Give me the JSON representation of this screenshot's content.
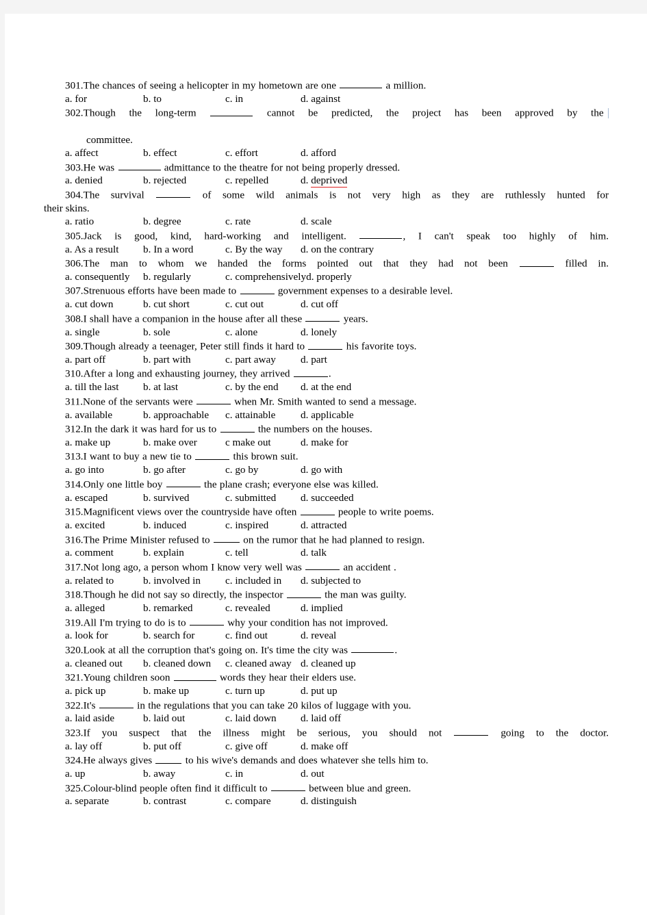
{
  "document": {
    "type": "english-multiple-choice-worksheet",
    "page_background": "#f4f4f4",
    "sheet_background": "#ffffff",
    "text_color": "#000000",
    "spellcheck_underline_color": "#e02020",
    "caret_color": "#a9bcd4"
  },
  "items": [
    {
      "number": "301.",
      "stem_before": "The chances of seeing a helicopter in my hometown are one",
      "stem_after": "a million.",
      "options": [
        "a. for",
        "b. to",
        "c. in",
        "d. against"
      ]
    },
    {
      "number": "302.",
      "stem_before": "Though the long-term",
      "stem_after": "cannot be predicted, the project has been approved by the",
      "continuation": "committee.",
      "options": [
        "a. affect",
        "b. effect",
        "c. effort",
        "d. afford"
      ]
    },
    {
      "number": "303.",
      "stem_before": "He was",
      "stem_after": "admittance to the theatre for not being properly dressed.",
      "options": [
        "a. denied",
        "b. rejected",
        "c. repelled",
        "d. deprived"
      ],
      "marked_option_index": 3
    },
    {
      "number": "304.",
      "stem_before": "The survival",
      "stem_after": "of some wild animals is not very high as they are ruthlessly hunted for",
      "continuation": "their skins.",
      "options": [
        "a. ratio",
        "b. degree",
        "c. rate",
        "d. scale"
      ]
    },
    {
      "number": "305.",
      "stem_before": "Jack is good, kind, hard-working and intelligent.",
      "stem_after": ", I can't speak too highly of him.",
      "options": [
        "a. As a result",
        "b. In a word",
        "c. By the way",
        "d. on the contrary"
      ]
    },
    {
      "number": "306.",
      "stem_before": "The man to whom we handed the forms pointed out that they had not been",
      "stem_after": "filled in.",
      "options": [
        "a. consequently",
        "b. regularly",
        "c. comprehensively",
        "d. properly"
      ]
    },
    {
      "number": "307.",
      "stem_before": "Strenuous efforts have been made to",
      "stem_after": "government expenses to a desirable level.",
      "options": [
        "a. cut down",
        "b. cut short",
        "c. cut out",
        "d. cut off"
      ]
    },
    {
      "number": "308.",
      "stem_before": "I shall have a companion in the house after all these",
      "stem_after": "years.",
      "options": [
        "a. single",
        "b. sole",
        "c. alone",
        "d. lonely"
      ]
    },
    {
      "number": "309.",
      "stem_before": "Though already a teenager, Peter still finds it hard to",
      "stem_after": "his favorite toys.",
      "options": [
        "a. part off",
        "b. part with",
        "c. part away",
        "d. part"
      ]
    },
    {
      "number": "310.",
      "stem_before": "After a long and exhausting journey, they arrived",
      "stem_after": ".",
      "options": [
        "a. till the last",
        "b. at last",
        "c. by the end",
        "d. at the end"
      ]
    },
    {
      "number": "311.",
      "stem_before": "None of the servants were",
      "stem_after": "when Mr. Smith wanted to send a message.",
      "options": [
        "a. available",
        "b. approachable",
        "c. attainable",
        "d. applicable"
      ]
    },
    {
      "number": "312.",
      "stem_before": "In the dark it was hard for us to",
      "stem_after": "the numbers on the houses.",
      "options": [
        "a. make up",
        "b. make over",
        "c make out",
        "d. make for"
      ]
    },
    {
      "number": "313.",
      "stem_before": "I want to buy a new tie to",
      "stem_after": "this brown suit.",
      "options": [
        "a. go into",
        "b. go after",
        "c. go by",
        "d. go with"
      ]
    },
    {
      "number": "314.",
      "stem_before": "Only one little boy",
      "stem_after": "the plane crash; everyone else was killed.",
      "options": [
        "a. escaped",
        "b. survived",
        "c. submitted",
        "d. succeeded"
      ]
    },
    {
      "number": "315.",
      "stem_before": "Magnificent views over the countryside have often",
      "stem_after": "people to write poems.",
      "options": [
        "a. excited",
        "b. induced",
        "c. inspired",
        "d. attracted"
      ]
    },
    {
      "number": "316.",
      "stem_before": "The Prime Minister refused to",
      "stem_after": "on the rumor that he had planned to resign.",
      "options": [
        "a. comment",
        "b. explain",
        "c. tell",
        "d. talk"
      ]
    },
    {
      "number": "317.",
      "stem_before": "Not long ago, a person whom I know very well was",
      "stem_after": "an accident .",
      "options": [
        "a. related to",
        "b. involved in",
        "c. included in",
        "d. subjected to"
      ]
    },
    {
      "number": "318.",
      "stem_before": "Though he did not say so directly, the inspector",
      "stem_after": "the man was guilty.",
      "options": [
        "a. alleged",
        "b. remarked",
        "c. revealed",
        "d. implied"
      ]
    },
    {
      "number": "319.",
      "stem_before": "All I'm trying to do is to",
      "stem_after": "why your condition has not improved.",
      "options": [
        "a. look for",
        "b. search for",
        "c. find out",
        "d. reveal"
      ]
    },
    {
      "number": "320.",
      "stem_before": "Look at all the corruption that's going on. It's time the city was",
      "stem_after": ".",
      "options": [
        "a. cleaned out",
        "b. cleaned down",
        "c. cleaned away",
        "d. cleaned up"
      ]
    },
    {
      "number": "321.",
      "stem_before": "Young children soon",
      "stem_after": "words they hear their elders use.",
      "options": [
        "a. pick up",
        "b. make up",
        "c. turn up",
        "d. put up"
      ]
    },
    {
      "number": "322.",
      "stem_before": "It's",
      "stem_after": "in the regulations that you can take 20 kilos of luggage with you.",
      "options": [
        "a. laid aside",
        "b. laid out",
        "c. laid down",
        "d. laid off"
      ]
    },
    {
      "number": "323.",
      "stem_before": "If you suspect that the illness might be serious, you should not",
      "stem_after": "going to the doctor.",
      "options": [
        "a. lay off",
        "b. put off",
        "c. give off",
        "d. make off"
      ]
    },
    {
      "number": "324.",
      "stem_before": "He always gives",
      "stem_after": "to his wive's demands and does whatever she tells him to.",
      "options": [
        "a. up",
        "b. away",
        "c. in",
        "d. out"
      ]
    },
    {
      "number": "325.",
      "stem_before": "Colour-blind people often find it difficult to",
      "stem_after": "between blue and green.",
      "options": [
        "a. separate",
        "b. contrast",
        "c. compare",
        "d. distinguish"
      ]
    }
  ]
}
